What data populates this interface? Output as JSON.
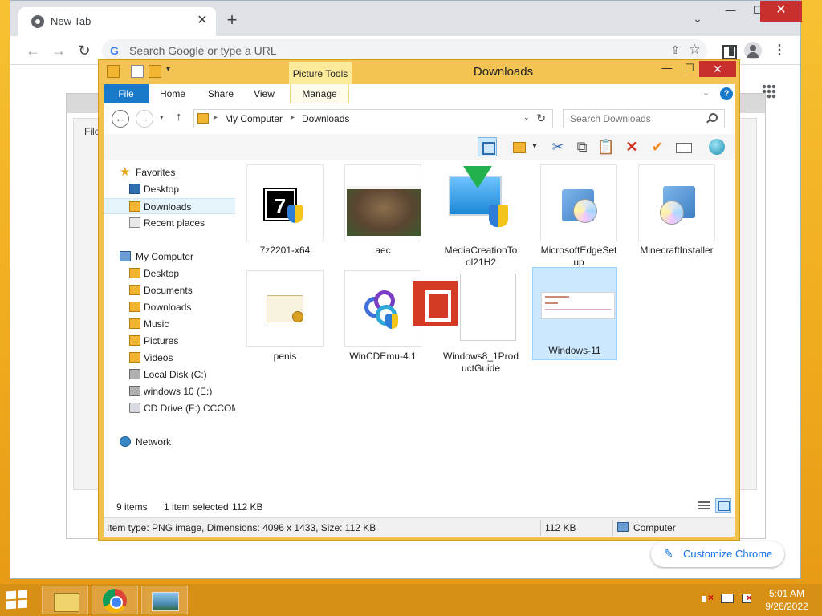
{
  "chrome": {
    "tab_title": "New Tab",
    "tab_close": "✕",
    "new_tab": "+",
    "tab_search": "⌄",
    "minimize": "—",
    "maximize": "☐",
    "close": "✕",
    "back": "←",
    "forward": "→",
    "reload": "↻",
    "google_g": "G",
    "omnibox_placeholder": "Search Google or type a URL",
    "share": "⇪",
    "bookmark": "☆",
    "menu": "⋮",
    "customize_label": "Customize Chrome",
    "pencil": "✎",
    "background_window_text": "File"
  },
  "explorer": {
    "title": "Downloads",
    "contextual_tab": "Picture Tools",
    "minimize": "—",
    "maximize": "☐",
    "close": "✕",
    "ribbon_tabs": [
      "File",
      "Home",
      "Share",
      "View",
      "Manage"
    ],
    "help": "?",
    "expand_ribbon": "⌄",
    "back": "←",
    "forward": "→",
    "recent": "▾",
    "up": "↑",
    "breadcrumb": [
      "My Computer",
      "Downloads"
    ],
    "breadcrumb_sep": "▸",
    "address_dropdown": "⌄",
    "refresh": "↻",
    "search_placeholder": "Search Downloads",
    "cmd_dropdown": "▾",
    "cut": "✂",
    "copy": "⧉",
    "paste": "📋",
    "delete": "✕",
    "rename": "✔",
    "nav": {
      "favorites": "Favorites",
      "fav_desktop": "Desktop",
      "fav_downloads": "Downloads",
      "fav_recent": "Recent places",
      "my_computer": "My Computer",
      "pc_desktop": "Desktop",
      "pc_documents": "Documents",
      "pc_downloads": "Downloads",
      "pc_music": "Music",
      "pc_pictures": "Pictures",
      "pc_videos": "Videos",
      "local_disk": "Local Disk (C:)",
      "windows10": "windows 10 (E:)",
      "cd_drive": "CD Drive (F:) CCCOM",
      "network": "Network"
    },
    "files": [
      {
        "name": "7z2201-x64",
        "icon": "7zip-installer-icon"
      },
      {
        "name": "aec",
        "icon": "image-thumbnail"
      },
      {
        "name": "MediaCreationTool21H2",
        "icon": "media-creation-tool-icon"
      },
      {
        "name": "MicrosoftEdgeSetup",
        "icon": "installer-icon"
      },
      {
        "name": "MinecraftInstaller",
        "icon": "installer-icon"
      },
      {
        "name": "penis",
        "icon": "certificate-icon"
      },
      {
        "name": "WinCDEmu-4.1",
        "icon": "wincdemu-icon"
      },
      {
        "name": "Windows8_1ProductGuide",
        "icon": "pdf-document-icon"
      },
      {
        "name": "Windows-11",
        "icon": "image-thumbnail"
      }
    ],
    "status": {
      "item_count": "9 items",
      "selected": "1 item selected",
      "selected_size": "112 KB"
    },
    "details": {
      "info": "Item type: PNG image, Dimensions: 4096 x 1433, Size: 112 KB",
      "size": "112 KB",
      "location": "Computer"
    }
  },
  "taskbar": {
    "time": "5:01 AM",
    "date": "9/26/2022"
  },
  "colors": {
    "desktop": "#f0aa1d",
    "explorer_frame": "#f0c14b",
    "file_tab": "#1979ca",
    "selection": "#cce8ff",
    "chrome_accent": "#1a73e8"
  }
}
